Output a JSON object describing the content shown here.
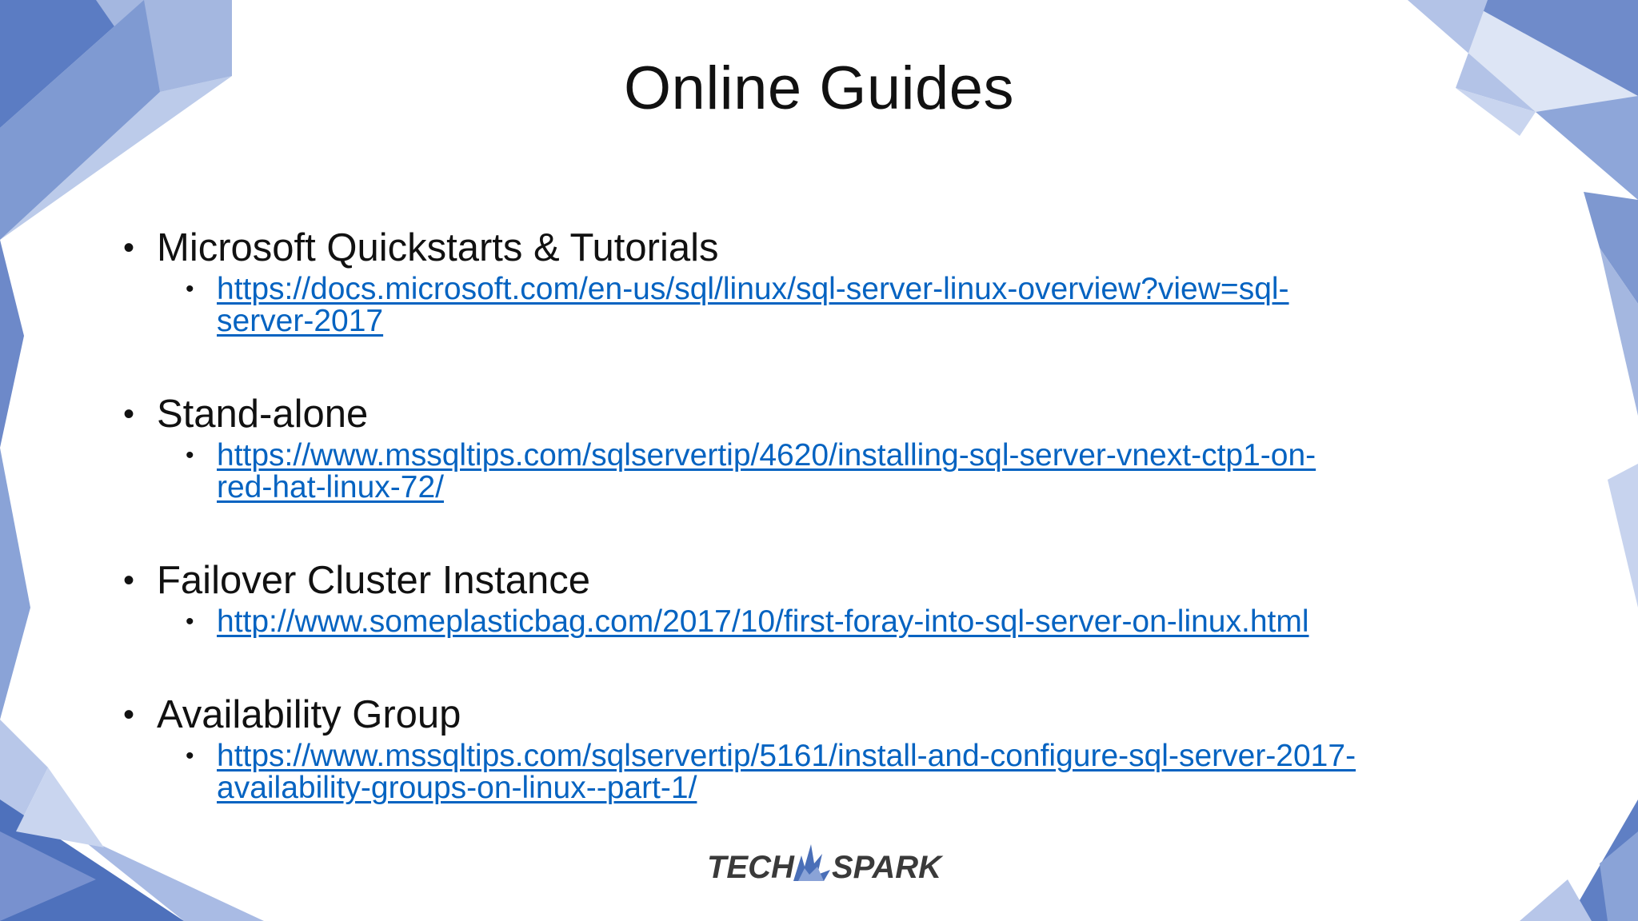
{
  "title": "Online Guides",
  "items": [
    {
      "heading": "Microsoft Quickstarts & Tutorials",
      "link_line1": "https://docs.microsoft.com/en-us/sql/linux/sql-server-linux-overview?view=sql-",
      "link_line2": "server-2017"
    },
    {
      "heading": "Stand-alone",
      "link_line1": "https://www.mssqltips.com/sqlservertip/4620/installing-sql-server-vnext-ctp1-on-",
      "link_line2": "red-hat-linux-72/"
    },
    {
      "heading": "Failover Cluster Instance",
      "link_line1": "http://www.someplasticbag.com/2017/10/first-foray-into-sql-server-on-linux.html",
      "link_line2": ""
    },
    {
      "heading": "Availability Group",
      "link_line1": "https://www.mssqltips.com/sqlservertip/5161/install-and-configure-sql-server-2017-",
      "link_line2": "availability-groups-on-linux--part-1/"
    }
  ],
  "bullet_char": "•",
  "logo": {
    "left_text": "TECH",
    "right_text": "SPARK",
    "icon": "spark-icon"
  },
  "colors": {
    "link": "#0563c1",
    "text": "#111111",
    "frame_blue": "#4a6fb8",
    "frame_light": "#a9bce6"
  }
}
